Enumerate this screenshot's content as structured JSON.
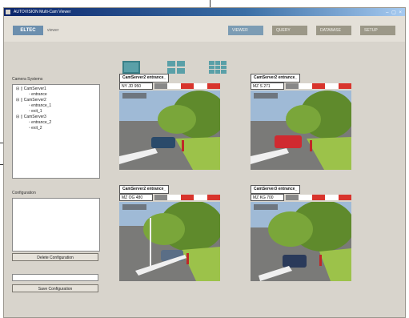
{
  "window": {
    "title": "AUTOVISION Multi-Cam Viewer"
  },
  "header": {
    "logo": "ELTEC",
    "logo_sub": "viewer"
  },
  "nav": {
    "tabs": [
      "VIEWER",
      "QUERY",
      "DATABASE",
      "SETUP"
    ],
    "active": "VIEWER"
  },
  "sidebar": {
    "camera_systems_label": "Camera Systems",
    "tree": [
      "CamServer1",
      "entrance",
      "CamServer2",
      "entrance_1",
      "exit_1",
      "CamServer3",
      "entrance_2",
      "exit_2"
    ],
    "configuration_label": "Configuration",
    "delete_button": "Delete Configuration",
    "save_button": "Save Configuration"
  },
  "layout_icons": [
    "single-view-icon",
    "quad-view-icon",
    "nine-view-icon"
  ],
  "cameras": [
    {
      "title": "CamServer2 entrance_",
      "plate": "NY JD 950"
    },
    {
      "title": "CamServer2 entrance_",
      "plate": "MZ S 271"
    },
    {
      "title": "CamServer2 entrance_",
      "plate": "MZ OG 480"
    },
    {
      "title": "CamServer3 entrance_",
      "plate": "MZ KG 700"
    }
  ],
  "colors": {
    "accent": "#7c9cb4",
    "alarm": "#d8342c",
    "tab": "#9c9888"
  }
}
